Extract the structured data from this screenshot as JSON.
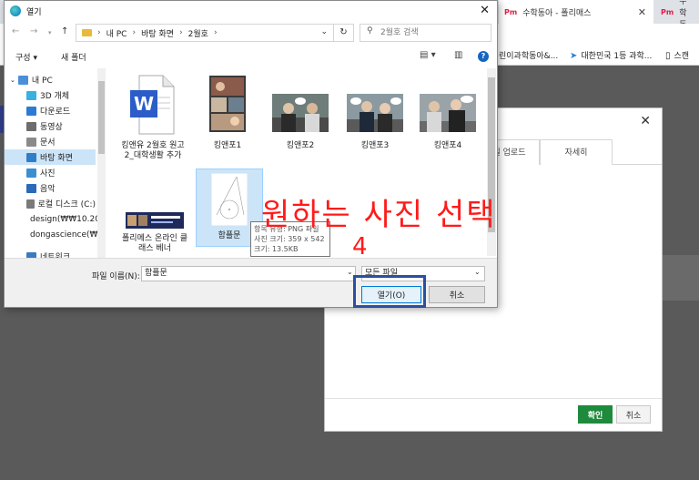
{
  "browser": {
    "tabs": [
      {
        "favicon": "Pm",
        "label": "수학동아 - 폴리매스"
      },
      {
        "favicon": "Pm",
        "label": "수학동"
      }
    ],
    "bookmarks": [
      {
        "label": "린이과학동아&..."
      },
      {
        "label": "대한민국 1등 과학..."
      },
      {
        "label": "스캔"
      }
    ]
  },
  "upload_modal": {
    "tabs": [
      "일 업로드",
      "자세히"
    ],
    "ok_label": "확인",
    "cancel_label": "취소"
  },
  "dialog": {
    "title": "열기",
    "address": [
      "내 PC",
      "바탕 화면",
      "2월호"
    ],
    "search_placeholder": "2월호 검색",
    "toolbar": {
      "organize": "구성",
      "new_folder": "새 폴더"
    },
    "nav_items": [
      {
        "label": "내 PC",
        "icon": "pc-icon",
        "color": "#4a90d9"
      },
      {
        "label": "3D 개체",
        "icon": "cube-icon",
        "color": "#3ab0e0"
      },
      {
        "label": "다운로드",
        "icon": "download-icon",
        "color": "#2b7bd6"
      },
      {
        "label": "동영상",
        "icon": "video-icon",
        "color": "#6d6d6d"
      },
      {
        "label": "문서",
        "icon": "document-icon",
        "color": "#8a8a8a"
      },
      {
        "label": "바탕 화면",
        "icon": "desktop-icon",
        "color": "#2f7ec8"
      },
      {
        "label": "사진",
        "icon": "pictures-icon",
        "color": "#3a8fd0"
      },
      {
        "label": "음악",
        "icon": "music-icon",
        "color": "#2a6ab8"
      },
      {
        "label": "로컬 디스크 (C:)",
        "icon": "disk-icon",
        "color": "#7a7a7a"
      },
      {
        "label": "design(₩₩10.20.",
        "icon": "network-drive-icon",
        "color": "#5a8f4a"
      },
      {
        "label": "dongascience(₩",
        "icon": "network-drive-icon",
        "color": "#5a8f4a"
      },
      {
        "label": "네트워크",
        "icon": "network-icon",
        "color": "#3a7ac0"
      }
    ],
    "files": [
      {
        "name": "킹앤유 2월호 원고2_대학생활 추가",
        "kind": "word"
      },
      {
        "name": "킹앤포1",
        "kind": "photo"
      },
      {
        "name": "킹앤포2",
        "kind": "photo"
      },
      {
        "name": "킹앤포3",
        "kind": "photo"
      },
      {
        "name": "킹앤포4",
        "kind": "photo"
      },
      {
        "name": "폴리메스 온라인 클래스 베너",
        "kind": "banner"
      },
      {
        "name": "함플문",
        "kind": "png"
      }
    ],
    "tooltip": {
      "type": "항목 유형: PNG 파일",
      "dimensions": "사진 크기: 359 x 542",
      "size": "크기: 13.5KB"
    },
    "filename_label": "파일 이름(N):",
    "filename_value": "함플문",
    "filetype_value": "모든 파일",
    "open_label": "열기(O)",
    "cancel_label": "취소"
  },
  "annotation": {
    "instruction": "원하는 사진 선택",
    "step": "4",
    "color": "#ff1a1a",
    "box_color": "#2a4fa3"
  }
}
